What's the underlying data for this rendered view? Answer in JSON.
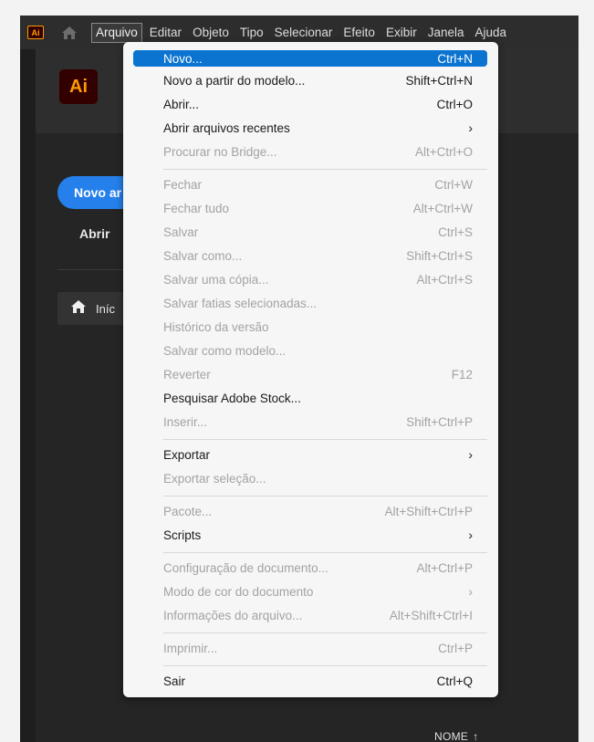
{
  "app": {
    "logo_small": "Ai",
    "logo_big": "Ai"
  },
  "menubar": {
    "items": [
      "Arquivo",
      "Editar",
      "Objeto",
      "Tipo",
      "Selecionar",
      "Efeito",
      "Exibir",
      "Janela",
      "Ajuda"
    ],
    "active": "Arquivo"
  },
  "home": {
    "new_button": "Novo ar",
    "open_button": "Abrir",
    "home_item": "Iníc",
    "name_sort": "NOME",
    "sort_arrow": "↑"
  },
  "menu": {
    "items": [
      {
        "label": "Novo...",
        "shortcut": "Ctrl+N",
        "enabled": true,
        "highlighted": true
      },
      {
        "label": "Novo a partir do modelo...",
        "shortcut": "Shift+Ctrl+N",
        "enabled": true
      },
      {
        "label": "Abrir...",
        "shortcut": "Ctrl+O",
        "enabled": true
      },
      {
        "label": "Abrir arquivos recentes",
        "shortcut": "",
        "enabled": true,
        "submenu": true
      },
      {
        "label": "Procurar no Bridge...",
        "shortcut": "Alt+Ctrl+O",
        "enabled": false
      },
      {
        "label": "Fechar",
        "shortcut": "Ctrl+W",
        "enabled": false
      },
      {
        "label": "Fechar tudo",
        "shortcut": "Alt+Ctrl+W",
        "enabled": false
      },
      {
        "label": "Salvar",
        "shortcut": "Ctrl+S",
        "enabled": false
      },
      {
        "label": "Salvar como...",
        "shortcut": "Shift+Ctrl+S",
        "enabled": false
      },
      {
        "label": "Salvar uma cópia...",
        "shortcut": "Alt+Ctrl+S",
        "enabled": false
      },
      {
        "label": "Salvar fatias selecionadas...",
        "shortcut": "",
        "enabled": false
      },
      {
        "label": "Histórico da versão",
        "shortcut": "",
        "enabled": false
      },
      {
        "label": "Salvar como modelo...",
        "shortcut": "",
        "enabled": false
      },
      {
        "label": "Reverter",
        "shortcut": "F12",
        "enabled": false
      },
      {
        "label": "Pesquisar Adobe Stock...",
        "shortcut": "",
        "enabled": true
      },
      {
        "label": "Inserir...",
        "shortcut": "Shift+Ctrl+P",
        "enabled": false
      },
      {
        "label": "Exportar",
        "shortcut": "",
        "enabled": true,
        "submenu": true
      },
      {
        "label": "Exportar seleção...",
        "shortcut": "",
        "enabled": false
      },
      {
        "label": "Pacote...",
        "shortcut": "Alt+Shift+Ctrl+P",
        "enabled": false
      },
      {
        "label": "Scripts",
        "shortcut": "",
        "enabled": true,
        "submenu": true
      },
      {
        "label": "Configuração de documento...",
        "shortcut": "Alt+Ctrl+P",
        "enabled": false
      },
      {
        "label": "Modo de cor do documento",
        "shortcut": "",
        "enabled": false,
        "submenu": true
      },
      {
        "label": "Informações do arquivo...",
        "shortcut": "Alt+Shift+Ctrl+I",
        "enabled": false
      },
      {
        "label": "Imprimir...",
        "shortcut": "Ctrl+P",
        "enabled": false
      },
      {
        "label": "Sair",
        "shortcut": "Ctrl+Q",
        "enabled": true
      }
    ],
    "submenu_arrow": "›"
  },
  "colors": {
    "accent": "#0b74d1",
    "new_button": "#2680eb",
    "ai_brand": "#ff9a00"
  }
}
